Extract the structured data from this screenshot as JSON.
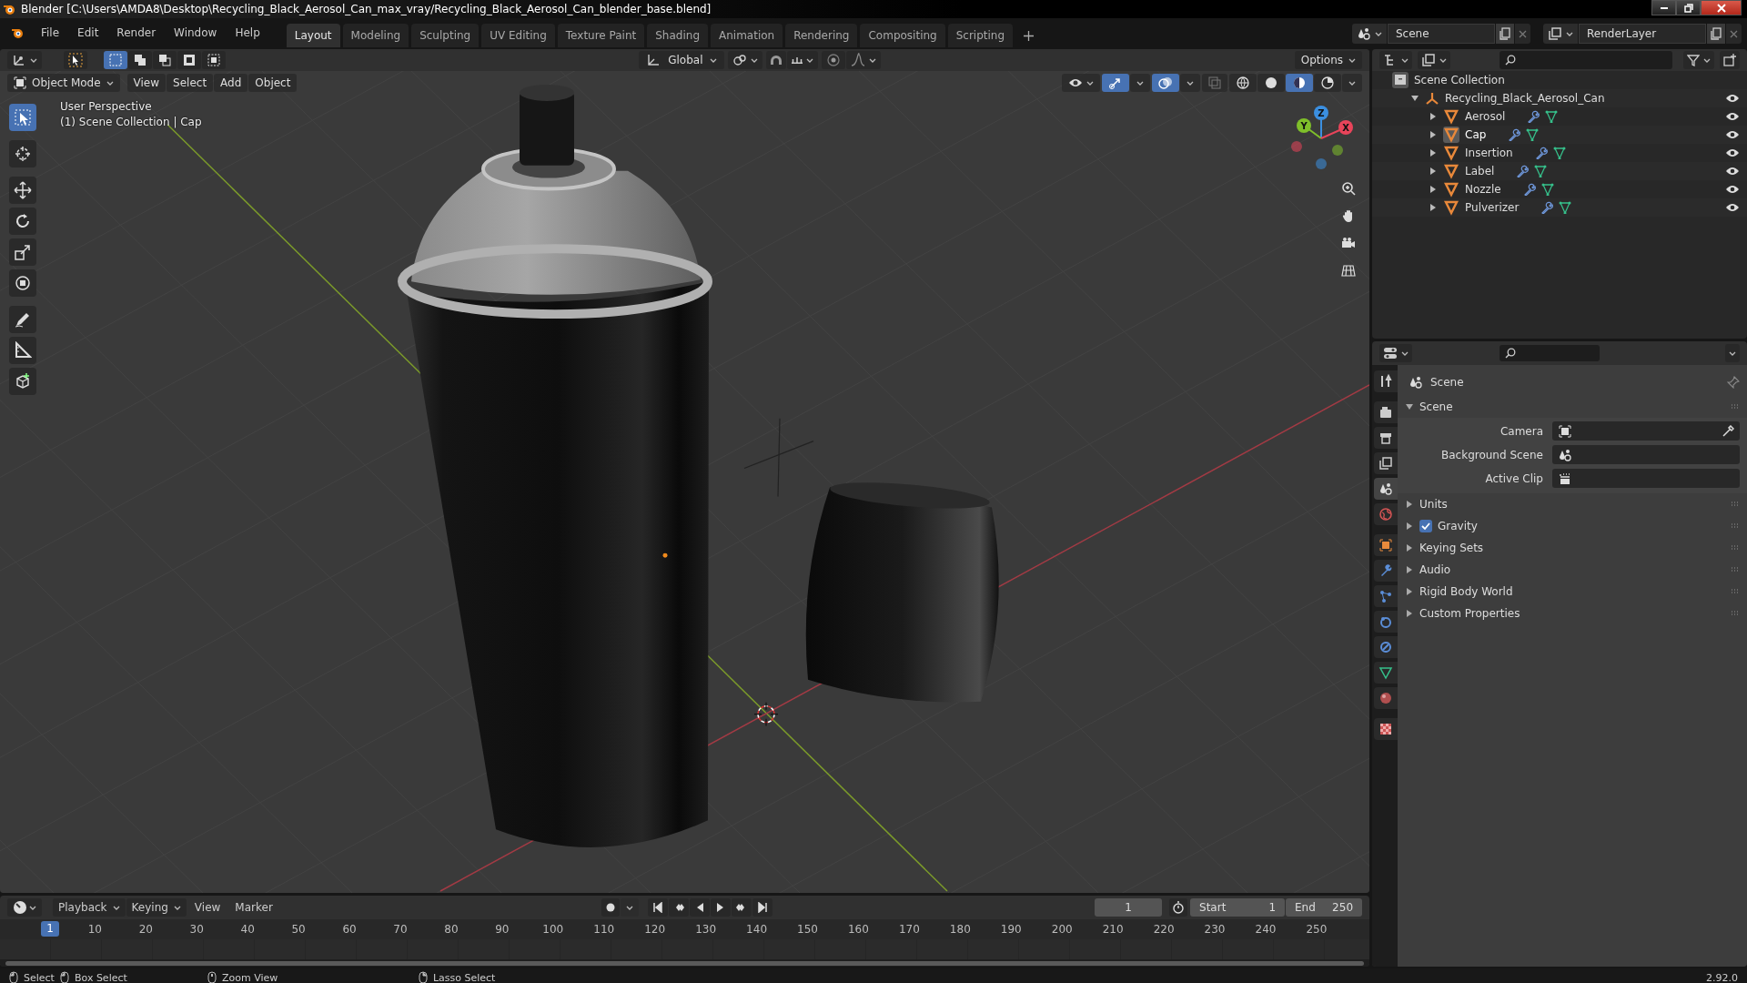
{
  "window": {
    "title": "Blender [C:\\Users\\AMDA8\\Desktop\\Recycling_Black_Aerosol_Can_max_vray/Recycling_Black_Aerosol_Can_blender_base.blend]"
  },
  "menu": [
    "File",
    "Edit",
    "Render",
    "Window",
    "Help"
  ],
  "workspace_tabs": [
    {
      "label": "Layout",
      "selected": true
    },
    {
      "label": "Modeling",
      "selected": false
    },
    {
      "label": "Sculpting",
      "selected": false
    },
    {
      "label": "UV Editing",
      "selected": false
    },
    {
      "label": "Texture Paint",
      "selected": false
    },
    {
      "label": "Shading",
      "selected": false
    },
    {
      "label": "Animation",
      "selected": false
    },
    {
      "label": "Rendering",
      "selected": false
    },
    {
      "label": "Compositing",
      "selected": false
    },
    {
      "label": "Scripting",
      "selected": false
    }
  ],
  "scene_selector": {
    "value": "Scene"
  },
  "view_layer_selector": {
    "value": "RenderLayer"
  },
  "tool_header": {
    "select_modes": [
      {
        "selected": true
      },
      {
        "selected": false
      },
      {
        "selected": false
      },
      {
        "selected": false
      },
      {
        "selected": false
      }
    ],
    "orientation": "Global",
    "options": "Options"
  },
  "viewport_header": {
    "mode": "Object Mode",
    "gizmos_on": true,
    "overlays_on": true,
    "menus": [
      "View",
      "Select",
      "Add",
      "Object"
    ],
    "shading_modes": [
      {
        "selected": false
      },
      {
        "selected": false
      },
      {
        "selected": true
      },
      {
        "selected": false
      }
    ]
  },
  "viewport": {
    "overlay_text": [
      "User Perspective",
      "(1) Scene Collection | Cap"
    ],
    "gizmo_axes": [
      {
        "label": "Z",
        "color": "#3b8fe0"
      },
      {
        "label": "Y",
        "color": "#7fbf2a"
      },
      {
        "label": "X",
        "color": "#e8445a"
      }
    ]
  },
  "outliner": {
    "root": "Scene Collection",
    "tree": [
      {
        "name": "Recycling_Black_Aerosol_Can",
        "expanded": true,
        "children": [
          {
            "name": "Aerosol",
            "expanded": false,
            "selected": false
          },
          {
            "name": "Cap",
            "expanded": false,
            "selected": true
          },
          {
            "name": "Insertion",
            "expanded": false,
            "selected": false
          },
          {
            "name": "Label",
            "expanded": false,
            "selected": false
          },
          {
            "name": "Nozzle",
            "expanded": false,
            "selected": false
          },
          {
            "name": "Pulverizer",
            "expanded": false,
            "selected": false
          }
        ]
      }
    ]
  },
  "property_tabs": [
    {
      "selected": false
    },
    {
      "selected": false
    },
    {
      "selected": false
    },
    {
      "selected": false
    },
    {
      "selected": true
    },
    {
      "selected": false
    },
    {
      "selected": false
    },
    {
      "selected": false
    },
    {
      "selected": false
    },
    {
      "selected": false
    },
    {
      "selected": false
    },
    {
      "selected": false
    },
    {
      "selected": false
    },
    {
      "selected": false
    }
  ],
  "properties": {
    "header": "Scene",
    "panels": [
      {
        "kind": "section",
        "title": "Scene",
        "expanded": true,
        "fields": [
          {
            "label": "Camera"
          },
          {
            "label": "Background Scene"
          },
          {
            "label": "Active Clip"
          }
        ]
      },
      {
        "kind": "section",
        "title": "Units",
        "expanded": false
      },
      {
        "kind": "checkbox",
        "title": "Gravity",
        "expanded": false,
        "checked": true
      },
      {
        "kind": "section",
        "title": "Keying Sets",
        "expanded": false
      },
      {
        "kind": "section",
        "title": "Audio",
        "expanded": false
      },
      {
        "kind": "section",
        "title": "Rigid Body World",
        "expanded": false
      },
      {
        "kind": "section",
        "title": "Custom Properties",
        "expanded": false
      }
    ]
  },
  "timeline": {
    "menus": [
      "Playback",
      "Keying"
    ],
    "links": [
      "View",
      "Marker"
    ],
    "current_frame": "1",
    "start_label": "Start",
    "start": "1",
    "end_label": "End",
    "end": "250",
    "playhead": "1",
    "ticks": [
      "10",
      "20",
      "30",
      "40",
      "50",
      "60",
      "70",
      "80",
      "90",
      "100",
      "110",
      "120",
      "130",
      "140",
      "150",
      "160",
      "170",
      "180",
      "190",
      "200",
      "210",
      "220",
      "230",
      "240",
      "250"
    ]
  },
  "status_bar": {
    "hints": [
      "Select",
      "Box Select",
      "Zoom View",
      "Lasso Select"
    ],
    "version": "2.92.0"
  }
}
